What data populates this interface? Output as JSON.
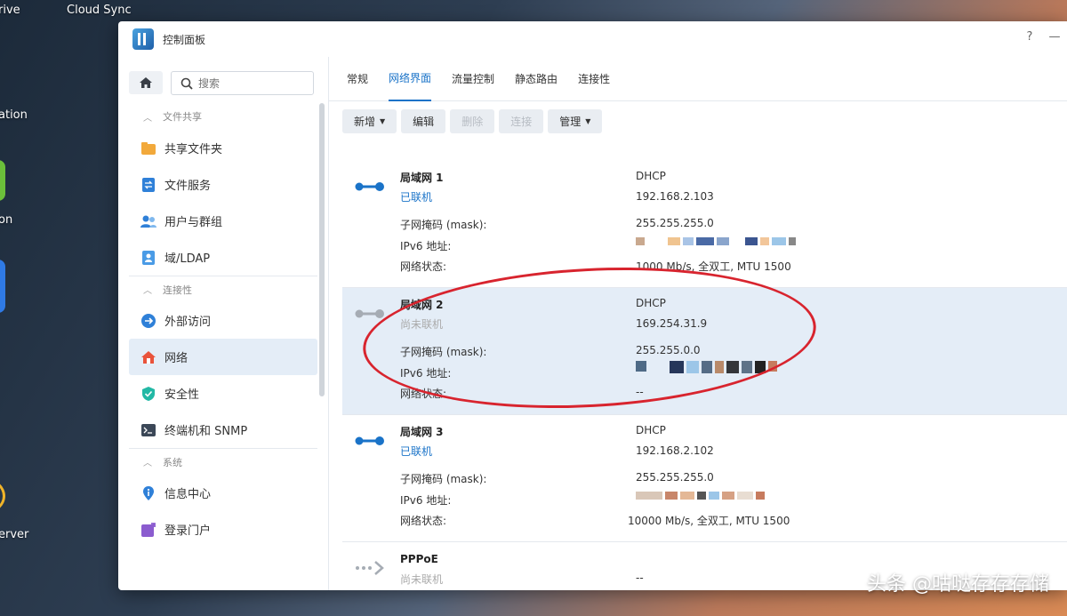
{
  "desktop": {
    "labels": [
      "rive",
      "Cloud Sync",
      "ation",
      "on",
      "erver"
    ]
  },
  "window": {
    "title": "控制面板",
    "help": "?",
    "minimize": "—"
  },
  "sidebar": {
    "search_placeholder": "搜索",
    "groups": [
      {
        "title": "文件共享",
        "items": [
          {
            "label": "共享文件夹",
            "icon": "folder-icon"
          },
          {
            "label": "文件服务",
            "icon": "file-service-icon"
          },
          {
            "label": "用户与群组",
            "icon": "users-icon"
          },
          {
            "label": "域/LDAP",
            "icon": "ldap-icon"
          }
        ]
      },
      {
        "title": "连接性",
        "items": [
          {
            "label": "外部访问",
            "icon": "external-access-icon"
          },
          {
            "label": "网络",
            "icon": "network-home-icon"
          },
          {
            "label": "安全性",
            "icon": "shield-icon"
          },
          {
            "label": "终端机和 SNMP",
            "icon": "terminal-icon"
          }
        ]
      },
      {
        "title": "系统",
        "items": [
          {
            "label": "信息中心",
            "icon": "info-icon"
          },
          {
            "label": "登录门户",
            "icon": "login-portal-icon"
          }
        ]
      }
    ]
  },
  "tabs": [
    "常规",
    "网络界面",
    "流量控制",
    "静态路由",
    "连接性"
  ],
  "toolbar": {
    "add": "新增",
    "edit": "编辑",
    "delete": "删除",
    "connect": "连接",
    "manage": "管理"
  },
  "interfaces": [
    {
      "name": "局域网 1",
      "status": "已联机",
      "connected": true,
      "mode": "DHCP",
      "ip": "192.168.2.103",
      "mask_label": "子网掩码 (mask):",
      "mask": "255.255.255.0",
      "ipv6_label": "IPv6 地址:",
      "net_label": "网络状态:",
      "net_status": "1000 Mb/s, 全双工, MTU 1500"
    },
    {
      "name": "局域网 2",
      "status": "尚未联机",
      "connected": false,
      "mode": "DHCP",
      "ip": "169.254.31.9",
      "mask_label": "子网掩码 (mask):",
      "mask": "255.255.0.0",
      "ipv6_label": "IPv6 地址:",
      "net_label": "网络状态:",
      "net_status": "--"
    },
    {
      "name": "局域网 3",
      "status": "已联机",
      "connected": true,
      "mode": "DHCP",
      "ip": "192.168.2.102",
      "mask_label": "子网掩码 (mask):",
      "mask": "255.255.255.0",
      "ipv6_label": "IPv6 地址:",
      "net_label": "网络状态:",
      "net_status": "10000 Mb/s, 全双工, MTU 1500"
    },
    {
      "name": "PPPoE",
      "status": "尚未联机",
      "connected": false,
      "ip": "--"
    }
  ],
  "watermark": "头条 @咕哒存存存储",
  "colors": {
    "accent": "#1a73c8",
    "highlight": "#d8242e"
  }
}
